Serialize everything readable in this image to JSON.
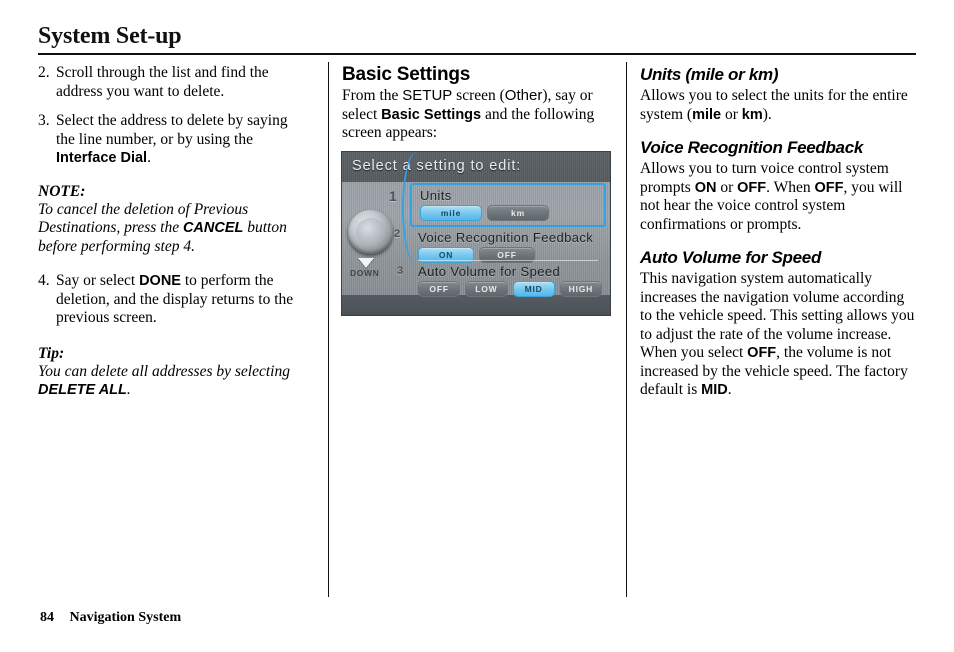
{
  "header": {
    "title": "System Set-up"
  },
  "footer": {
    "page_number": "84",
    "section": "Navigation System"
  },
  "left_column": {
    "steps": [
      {
        "number": "2.",
        "parts": [
          {
            "text": "Scroll through the list and find the address you want to delete.",
            "style": "plain"
          }
        ]
      },
      {
        "number": "3.",
        "parts": [
          {
            "text": "Select the address to delete by saying the line number, or by using the ",
            "style": "plain"
          },
          {
            "text": "Interface Dial",
            "style": "bold-sans"
          },
          {
            "text": ".",
            "style": "plain"
          }
        ]
      }
    ],
    "note": {
      "heading": "NOTE:",
      "parts": [
        {
          "text": "To cancel the deletion of Previous Destinations, press the ",
          "style": "italic"
        },
        {
          "text": "CANCEL",
          "style": "bold-sans"
        },
        {
          "text": " button before performing step 4.",
          "style": "italic"
        }
      ]
    },
    "step4": {
      "number": "4.",
      "parts": [
        {
          "text": "Say or select ",
          "style": "plain"
        },
        {
          "text": "DONE",
          "style": "bold-sans"
        },
        {
          "text": " to perform the deletion, and the display returns to the previous screen.",
          "style": "plain"
        }
      ]
    },
    "tip": {
      "heading": "Tip:",
      "parts": [
        {
          "text": "You can delete all addresses by selecting ",
          "style": "italic"
        },
        {
          "text": "DELETE ALL",
          "style": "bold-sans"
        },
        {
          "text": ".",
          "style": "italic"
        }
      ]
    }
  },
  "middle_column": {
    "heading": "Basic Settings",
    "intro_parts": [
      {
        "text": "From the ",
        "style": "plain"
      },
      {
        "text": "SETUP",
        "style": "sans"
      },
      {
        "text": " screen (",
        "style": "plain"
      },
      {
        "text": "Other",
        "style": "sans"
      },
      {
        "text": "), say or select ",
        "style": "plain"
      },
      {
        "text": "Basic Settings",
        "style": "bold-sans"
      },
      {
        "text": " and the following screen appears:",
        "style": "plain"
      }
    ],
    "nav_screen": {
      "title": "Select a setting to edit:",
      "dial_numbers": [
        "1",
        "2",
        "3"
      ],
      "down_label": "DOWN",
      "highlight_color": "#2fa3e8",
      "selected_button_color": "#74c6ef",
      "rows": [
        {
          "label": "Units",
          "selected": "mile",
          "buttons": [
            "mile",
            "km"
          ]
        },
        {
          "label": "Voice Recognition Feedback",
          "selected": "ON",
          "buttons": [
            "ON",
            "OFF"
          ]
        },
        {
          "label": "Auto Volume for Speed",
          "selected": "MID",
          "buttons": [
            "OFF",
            "LOW",
            "MID",
            "HIGH"
          ]
        }
      ]
    }
  },
  "right_column": {
    "sections": [
      {
        "heading": "Units (mile or km)",
        "parts": [
          {
            "text": "Allows you to select the units for the entire system (",
            "style": "plain"
          },
          {
            "text": "mile",
            "style": "bold-sans"
          },
          {
            "text": " or ",
            "style": "plain"
          },
          {
            "text": "km",
            "style": "bold-sans"
          },
          {
            "text": ").",
            "style": "plain"
          }
        ]
      },
      {
        "heading": "Voice Recognition Feedback",
        "parts": [
          {
            "text": "Allows you to turn voice control system prompts ",
            "style": "plain"
          },
          {
            "text": "ON",
            "style": "bold-sans"
          },
          {
            "text": " or ",
            "style": "plain"
          },
          {
            "text": "OFF",
            "style": "bold-sans"
          },
          {
            "text": ". When ",
            "style": "plain"
          },
          {
            "text": "OFF",
            "style": "bold-sans"
          },
          {
            "text": ", you will not hear the voice control system confirmations or prompts.",
            "style": "plain"
          }
        ]
      },
      {
        "heading": "Auto Volume for Speed",
        "parts": [
          {
            "text": "This navigation system automatically increases the navigation volume according to the vehicle speed. This setting allows you to adjust the rate of the volume increase.",
            "style": "plain"
          },
          {
            "text": "BREAK",
            "style": "break"
          },
          {
            "text": "When you select ",
            "style": "plain"
          },
          {
            "text": "OFF",
            "style": "bold-sans"
          },
          {
            "text": ", the volume is not increased by the vehicle speed. The factory default is ",
            "style": "plain"
          },
          {
            "text": "MID",
            "style": "bold-sans"
          },
          {
            "text": ".",
            "style": "plain"
          }
        ]
      }
    ]
  }
}
